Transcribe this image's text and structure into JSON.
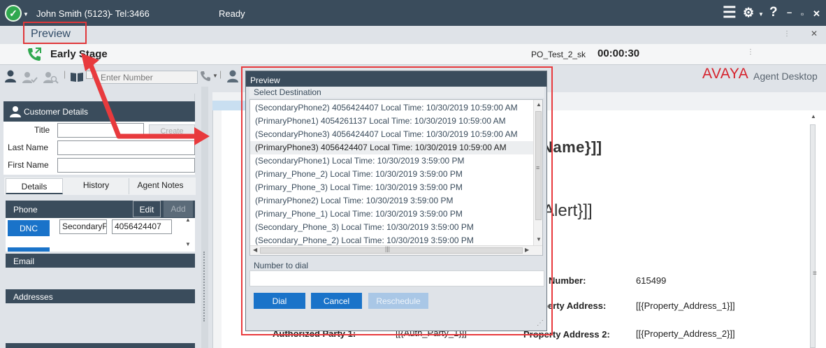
{
  "topbar": {
    "agent": "John Smith (5123)",
    "tel": "- Tel:3466",
    "status": "Ready"
  },
  "preview_label": "Preview",
  "call": {
    "stage": "Early Stage",
    "campaign": "PO_Test_2_sk",
    "timer": "00:00:30"
  },
  "number_input": {
    "placeholder": "Enter Number"
  },
  "brand": {
    "logo": "AVAYA",
    "product": "Agent Desktop"
  },
  "customer": {
    "title": "Customer Details",
    "title_label": "Title",
    "create": "Create",
    "last_name_label": "Last Name",
    "first_name_label": "First Name"
  },
  "tabs": [
    "Details",
    "History",
    "Agent Notes"
  ],
  "phone": {
    "header": "Phone",
    "edit": "Edit",
    "add": "Add",
    "dnc": "DNC",
    "type": "SecondaryF",
    "number": "4056424407"
  },
  "sections": {
    "email": "Email",
    "addresses": "Addresses"
  },
  "dialog": {
    "title": "Preview",
    "select_destination": "Select Destination",
    "destinations": [
      "(SecondaryPhone2) 4056424407   Local Time: 10/30/2019 10:59:00 AM",
      "(PrimaryPhone1) 4054261137   Local Time: 10/30/2019 10:59:00 AM",
      "(SecondaryPhone3) 4056424407   Local Time: 10/30/2019 10:59:00 AM",
      "(PrimaryPhone3) 4056424407   Local Time: 10/30/2019 10:59:00 AM",
      "(SecondaryPhone1)   Local Time: 10/30/2019 3:59:00 PM",
      "(Primary_Phone_2)   Local Time: 10/30/2019 3:59:00 PM",
      "(Primary_Phone_3)   Local Time: 10/30/2019 3:59:00 PM",
      "(PrimaryPhone2)   Local Time: 10/30/2019 3:59:00 PM",
      "(Primary_Phone_1)   Local Time: 10/30/2019 3:59:00 PM",
      "(Secondary_Phone_3)   Local Time: 10/30/2019 3:59:00 PM",
      "(Secondary_Phone_2)   Local Time: 10/30/2019 3:59:00 PM"
    ],
    "selected_index": 3,
    "number_to_dial": "Number to dial",
    "dial": "Dial",
    "cancel": "Cancel",
    "reschedule": "Reschedule"
  },
  "script": {
    "name_frag": "Name}]]",
    "alert_frag": "Alert}]]",
    "number_label": "Number:",
    "number_value": "615499",
    "prop1_label": "perty Address:",
    "prop1_value": "[[{Property_Address_1}]]",
    "prop2_label": "Property Address 2:",
    "prop2_value": "[[{Property_Address_2}]]",
    "auth_label": "Authorized Party 1:",
    "auth_value": "[[{Auth_Party_1}]]"
  },
  "colors": {
    "accent": "#1a73c9",
    "header": "#3a4c5c",
    "highlight": "#e83a3d"
  }
}
